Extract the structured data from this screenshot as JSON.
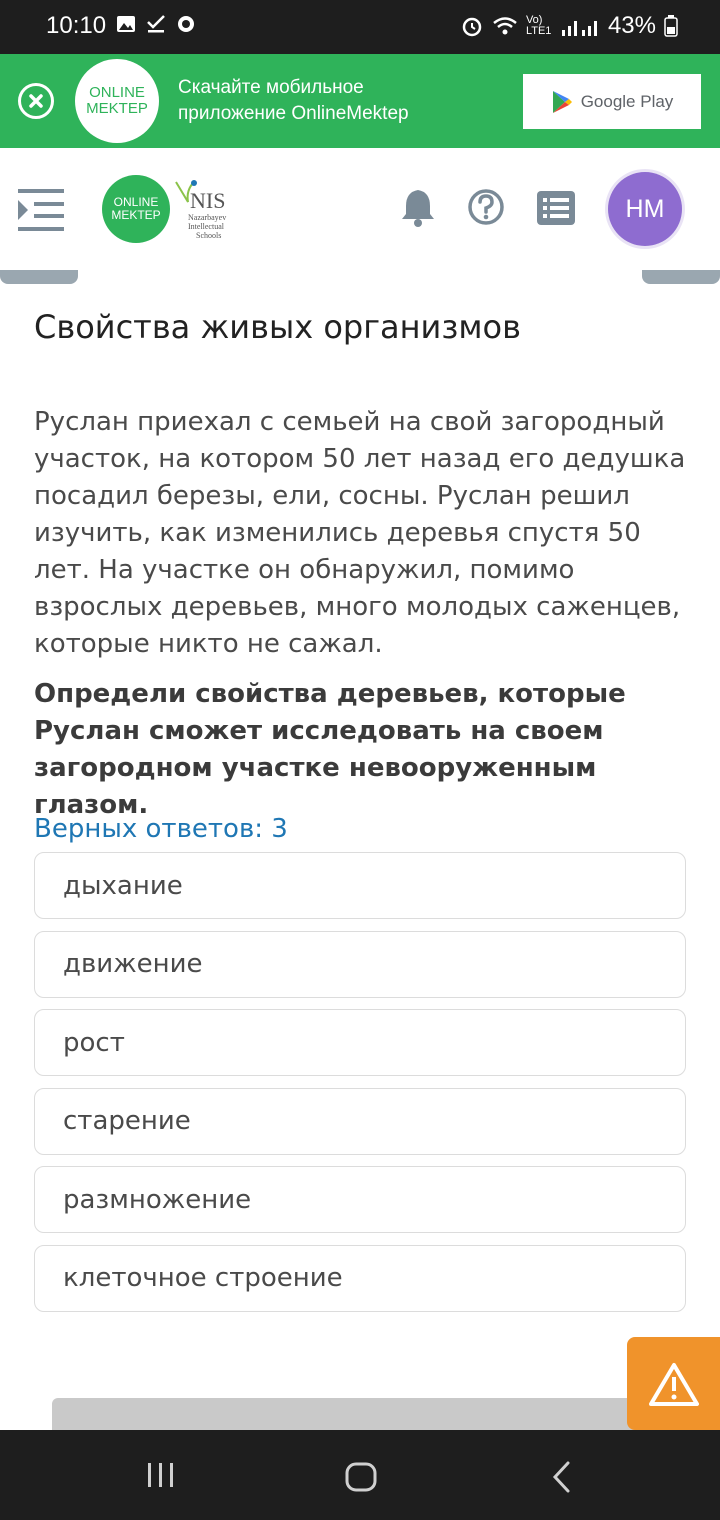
{
  "status_bar": {
    "time": "10:10",
    "network": "Vo) LTE1",
    "battery": "43%"
  },
  "app_banner": {
    "logo_line1": "ONLINE",
    "logo_line2": "MEKTEP",
    "text_line1": "Скачайте мобильное",
    "text_line2": "приложение OnlineMektep",
    "store_button": "Google Play"
  },
  "header": {
    "logo_line1": "ONLINE",
    "logo_line2": "MEKTEP",
    "nis_title": "NIS",
    "nis_sub1": "Nazarbayev",
    "nis_sub2": "Intellectual",
    "nis_sub3": "Schools",
    "avatar_initials": "HM"
  },
  "page": {
    "title": "Свойства живых организмов",
    "paragraph": "Руслан приехал с семьей на свой загородный участок, на котором 50 лет назад его дедушка посадил березы, ели, сосны. Руслан решил изучить, как изменились деревья спустя 50 лет. На участке он обнаружил, помимо взрослых деревьев, много молодых саженцев, которые никто не сажал.",
    "question": "Определи свойства деревьев, которые Руслан сможет исследовать на своем загородном участке невооруженным глазом.",
    "answers_count": "Верных ответов: 3",
    "options": [
      "дыхание",
      "движение",
      "рост",
      "старение",
      "размножение",
      "клеточное строение"
    ]
  },
  "colors": {
    "brand_green": "#2fb35a",
    "avatar": "#8e6cd0",
    "accent_blue": "#1f77b4",
    "warning": "#f0932b"
  },
  "icons": [
    "close-icon",
    "menu-icon",
    "bell-icon",
    "help-icon",
    "list-icon",
    "warning-icon",
    "recent-apps-icon",
    "home-icon",
    "back-icon"
  ]
}
